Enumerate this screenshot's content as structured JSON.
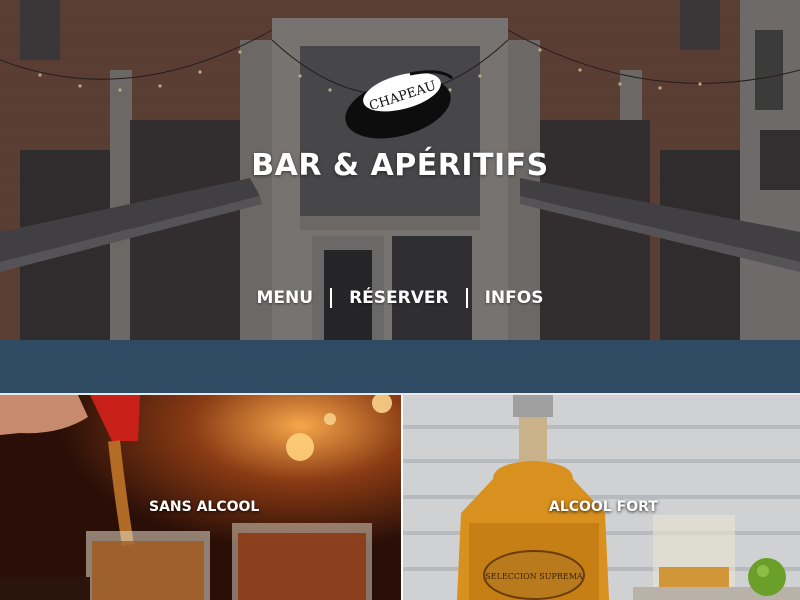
{
  "brand": {
    "logo_text": "CHAPEAU",
    "tagline": "BAR & APÉRITIFS"
  },
  "nav": {
    "items": [
      {
        "label": "MENU"
      },
      {
        "label": "RÉSERVER"
      },
      {
        "label": "INFOS"
      }
    ]
  },
  "categories": [
    {
      "label": "SANS ALCOOL"
    },
    {
      "label": "ALCOOL FORT",
      "bottle_label": "SELECCION SUPREMA"
    }
  ],
  "colors": {
    "band": "#2f4a63",
    "text": "#ffffff",
    "brick": "#7a4f40",
    "stone": "#9b9893"
  },
  "icons": [
    "hat-logo-icon"
  ]
}
